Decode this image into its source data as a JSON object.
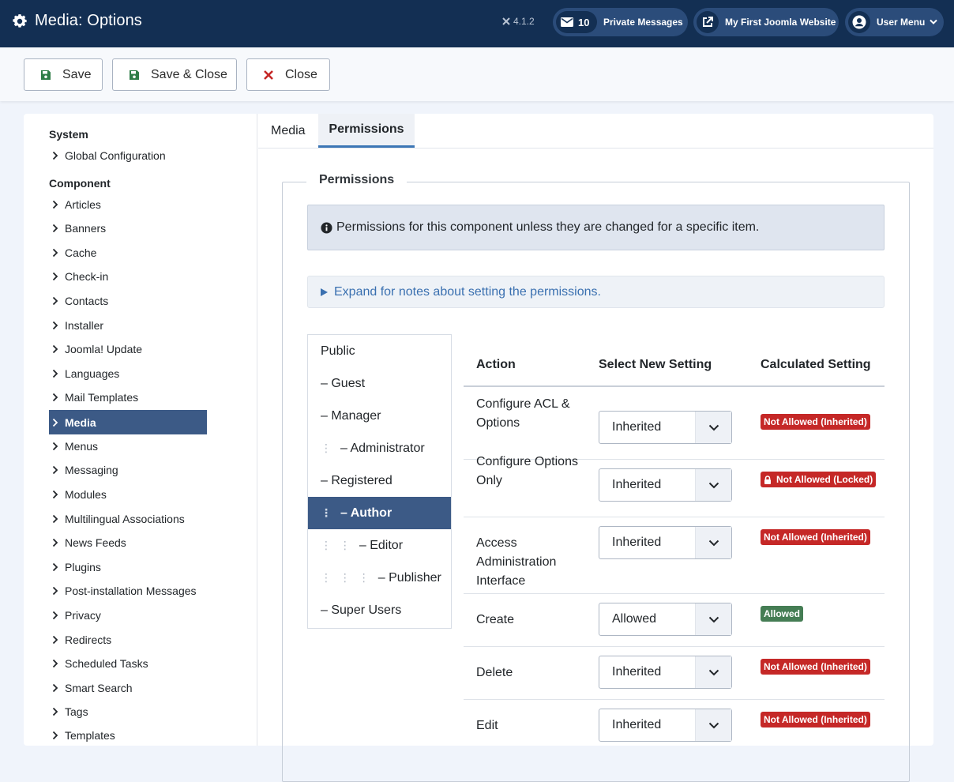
{
  "header": {
    "title": "Media: Options",
    "version": "4.1.2",
    "messages_count": "10",
    "messages_label": "Private Messages",
    "site_label": "My First Joomla Website",
    "user_label": "User Menu"
  },
  "toolbar": {
    "save_label": "Save",
    "save_close_label": "Save & Close",
    "close_label": "Close"
  },
  "sidebar": {
    "system_heading": "System",
    "system_items": [
      "Global Configuration"
    ],
    "component_heading": "Component",
    "items": [
      "Articles",
      "Banners",
      "Cache",
      "Check-in",
      "Contacts",
      "Installer",
      "Joomla! Update",
      "Languages",
      "Mail Templates",
      "Media",
      "Menus",
      "Messaging",
      "Modules",
      "Multilingual Associations",
      "News Feeds",
      "Plugins",
      "Post-installation Messages",
      "Privacy",
      "Redirects",
      "Scheduled Tasks",
      "Smart Search",
      "Tags",
      "Templates"
    ],
    "active": "Media"
  },
  "tabs": [
    "Media",
    "Permissions"
  ],
  "active_tab": "Permissions",
  "permissions": {
    "legend": "Permissions",
    "info": "Permissions for this component unless they are changed for a specific item.",
    "expand_label": "Expand for notes about setting the permissions.",
    "groups": [
      {
        "label": "Public",
        "depth": 0
      },
      {
        "label": "– Guest",
        "depth": 0
      },
      {
        "label": "– Manager",
        "depth": 0
      },
      {
        "label": "– Administrator",
        "depth": 1
      },
      {
        "label": "– Registered",
        "depth": 0
      },
      {
        "label": "– Author",
        "depth": 1
      },
      {
        "label": "– Editor",
        "depth": 2
      },
      {
        "label": "– Publisher",
        "depth": 3
      },
      {
        "label": "– Super Users",
        "depth": 0
      }
    ],
    "active_group": "– Author",
    "columns": [
      "Action",
      "Select New Setting",
      "Calculated Setting"
    ],
    "rows": [
      {
        "action": "Configure ACL & Options",
        "setting": "Inherited",
        "calculated": "Not Allowed (Inherited)",
        "status": "denied"
      },
      {
        "action": "Configure Options Only",
        "setting": "Inherited",
        "calculated": "Not Allowed (Locked)",
        "status": "locked"
      },
      {
        "action": "Access Administration Interface",
        "setting": "Inherited",
        "calculated": "Not Allowed (Inherited)",
        "status": "denied"
      },
      {
        "action": "Create",
        "setting": "Allowed",
        "calculated": "Allowed",
        "status": "allowed"
      },
      {
        "action": "Delete",
        "setting": "Inherited",
        "calculated": "Not Allowed (Inherited)",
        "status": "denied"
      },
      {
        "action": "Edit",
        "setting": "Inherited",
        "calculated": "Not Allowed (Inherited)",
        "status": "denied"
      }
    ]
  },
  "colors": {
    "header_bg": "#132f53",
    "active_bg": "#3c5a86",
    "denied": "#c52827",
    "allowed": "#457d54",
    "link": "#3a70b0"
  }
}
